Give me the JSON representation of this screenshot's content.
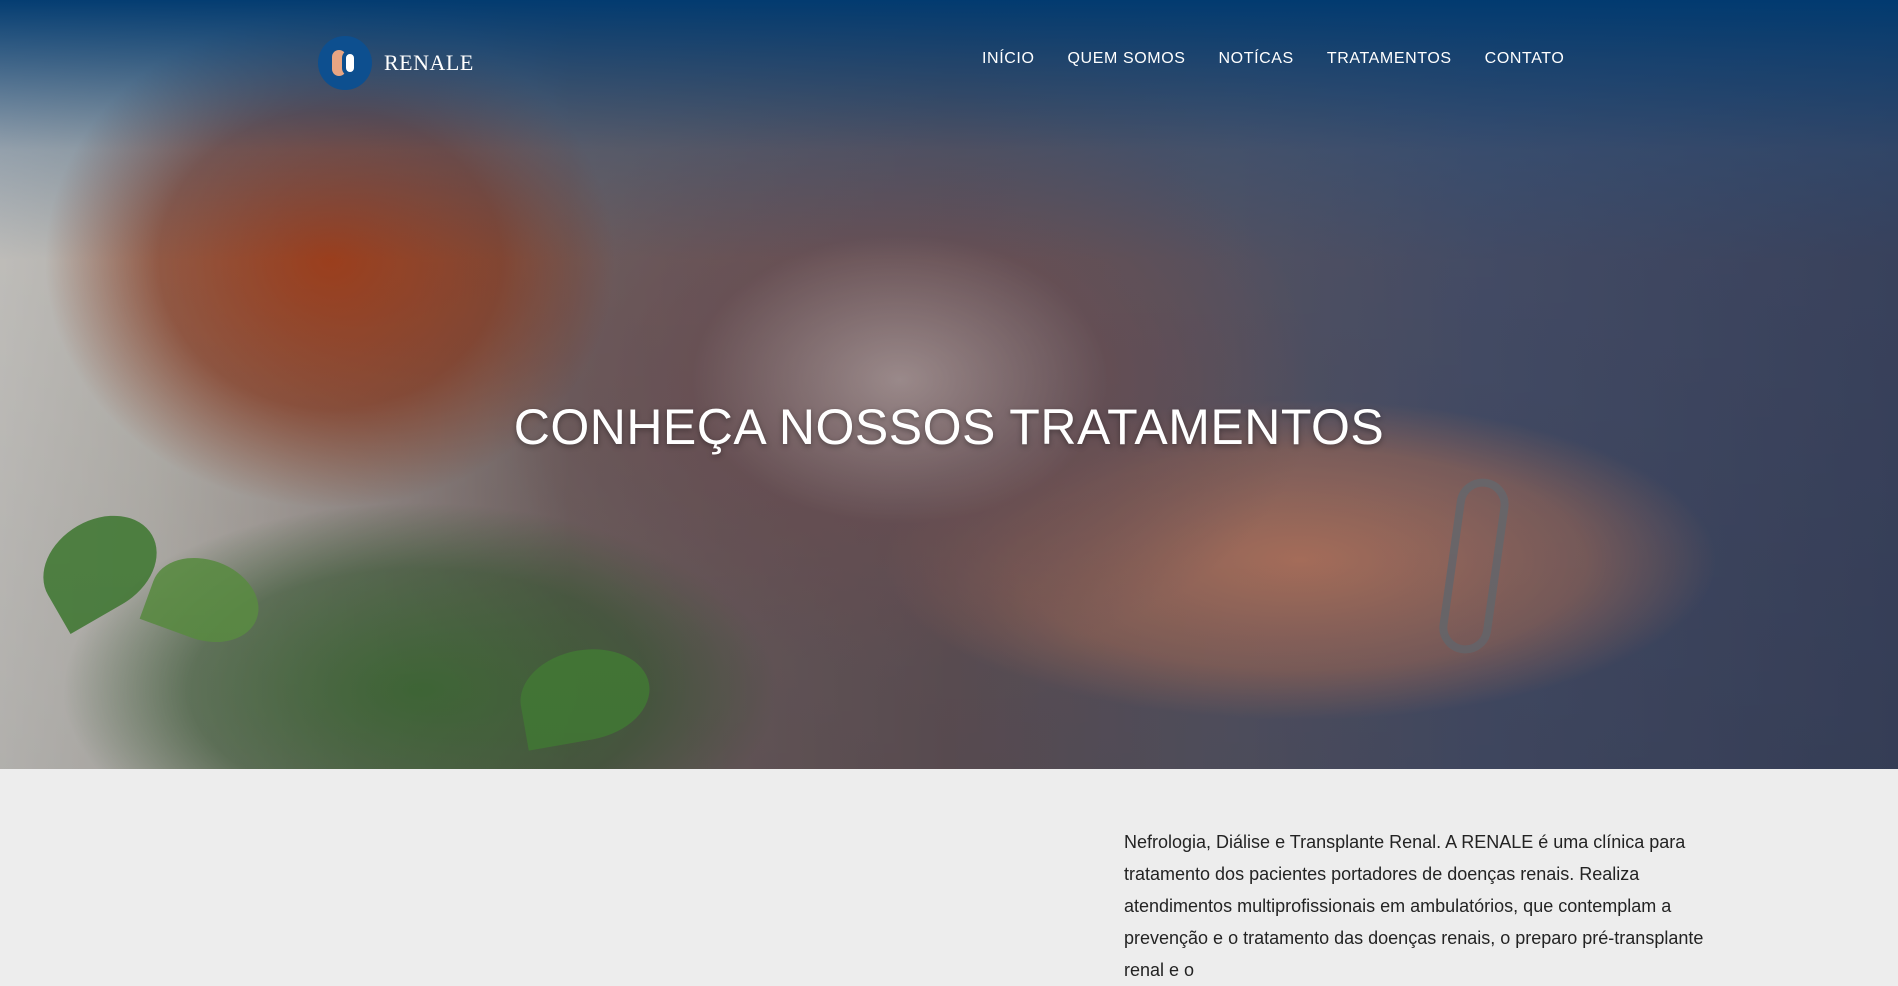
{
  "brand": {
    "name": "RENALE"
  },
  "nav": {
    "items": [
      "INÍCIO",
      "QUEM SOMOS",
      "NOTÍCAS",
      "TRATAMENTOS",
      "CONTATO"
    ]
  },
  "hero": {
    "title": "CONHEÇA NOSSOS TRATAMENTOS"
  },
  "content": {
    "paragraph": "Nefrologia, Diálise e Transplante Renal. A RENALE é uma clínica para tratamento dos pacientes portadores de doenças renais. Realiza atendimentos multiprofissionais em ambulatórios, que contemplam a prevenção e o tratamento das doenças renais, o preparo pré-transplante renal e o"
  },
  "colors": {
    "nav_gradient": "#003a70",
    "accent": "#0d4f8f",
    "page_bg": "#ededed",
    "text": "#232323"
  }
}
